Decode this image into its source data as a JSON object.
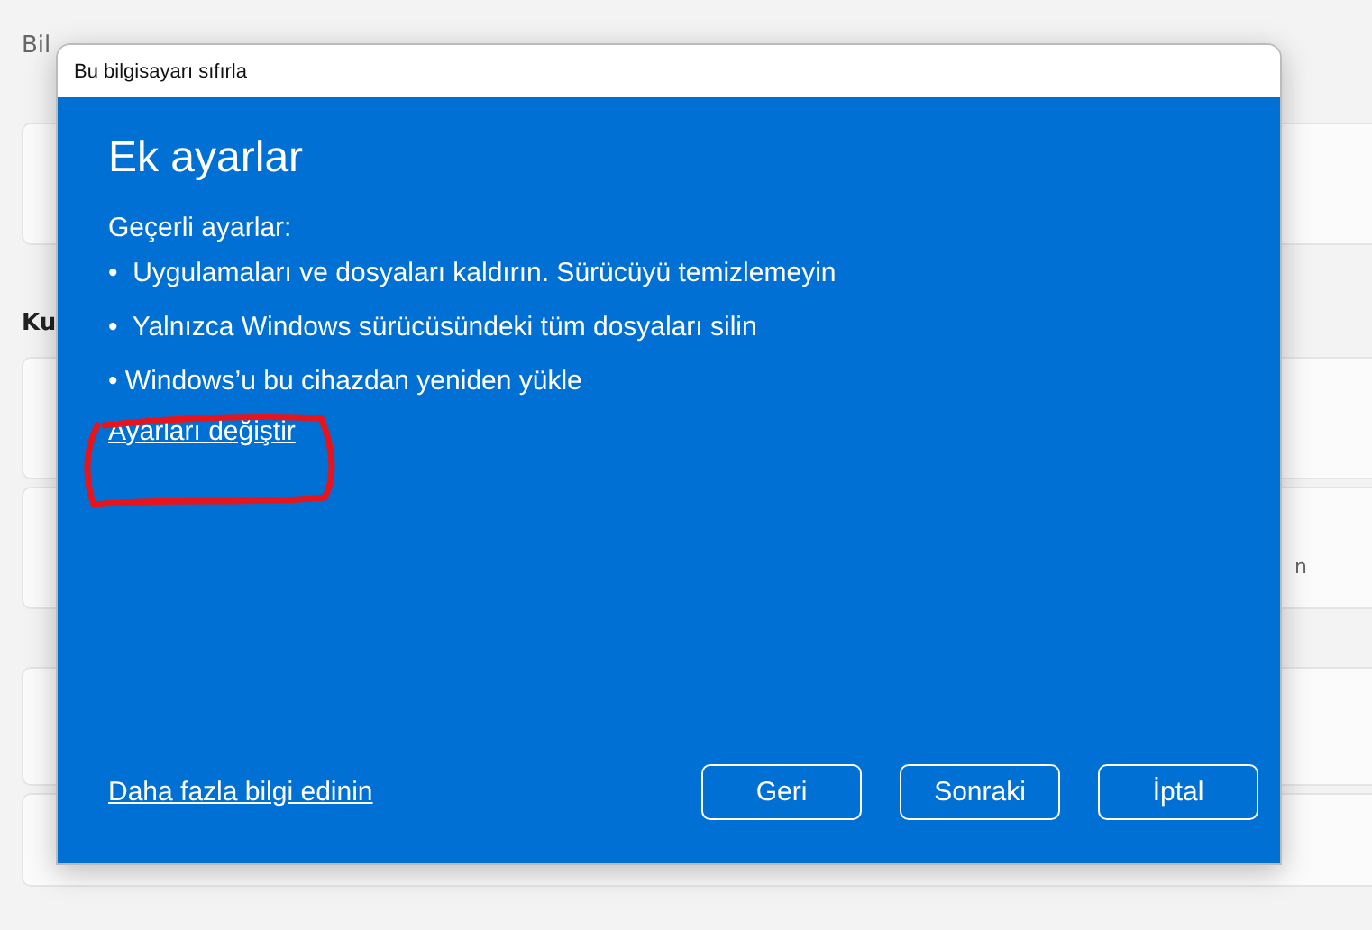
{
  "background": {
    "top_text": "Bil",
    "section_heading": "Ku",
    "card_text": "n"
  },
  "dialog": {
    "title": "Bu bilgisayarı sıfırla",
    "heading": "Ek ayarlar",
    "intro": "Geçerli ayarlar:",
    "items": [
      "•  Uygulamaları ve dosyaları kaldırın. Sürücüyü temizlemeyin",
      "•  Yalnızca Windows sürücüsündeki tüm dosyaları silin",
      "• Windows’u bu cihazdan yeniden yükle"
    ],
    "change_link": "Ayarları değiştir",
    "more_link": "Daha fazla bilgi edinin",
    "buttons": [
      "Geri",
      "Sonraki",
      "İptal"
    ]
  }
}
